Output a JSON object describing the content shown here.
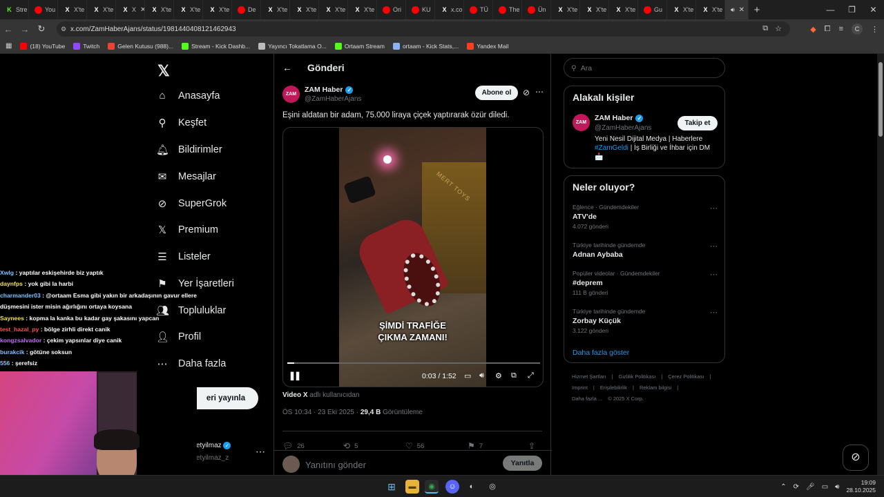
{
  "browser": {
    "tabs": [
      {
        "label": "Stre",
        "icon": "kick-icon",
        "color": "#53fc18"
      },
      {
        "label": "You",
        "icon": "youtube-icon",
        "color": "#ff0000"
      },
      {
        "label": "X'te",
        "icon": "x-icon",
        "color": "#ffffff"
      },
      {
        "label": "X'te",
        "icon": "x-icon",
        "color": "#ffffff"
      },
      {
        "label": "X",
        "icon": "x-icon",
        "color": "#ffffff"
      },
      {
        "label": "X'te",
        "icon": "x-icon",
        "color": "#ffffff"
      },
      {
        "label": "X'te",
        "icon": "x-icon",
        "color": "#ffffff"
      },
      {
        "label": "X'te",
        "icon": "x-icon",
        "color": "#ffffff"
      },
      {
        "label": "De",
        "icon": "youtube-icon",
        "color": "#ff0000"
      },
      {
        "label": "X'te",
        "icon": "x-icon",
        "color": "#ffffff"
      },
      {
        "label": "X'te",
        "icon": "x-icon",
        "color": "#ffffff"
      },
      {
        "label": "X'te",
        "icon": "x-icon",
        "color": "#ffffff"
      },
      {
        "label": "X'te",
        "icon": "x-icon",
        "color": "#ffffff"
      },
      {
        "label": "Ori",
        "icon": "youtube-icon",
        "color": "#ff0000"
      },
      {
        "label": "KU",
        "icon": "youtube-icon",
        "color": "#ff0000"
      },
      {
        "label": "x.co",
        "icon": "x-icon",
        "color": "#ffffff"
      },
      {
        "label": "TÜ",
        "icon": "youtube-icon",
        "color": "#ff0000"
      },
      {
        "label": "The",
        "icon": "youtube-icon",
        "color": "#ff0000"
      },
      {
        "label": "Ün",
        "icon": "youtube-icon",
        "color": "#ff0000"
      },
      {
        "label": "X'te",
        "icon": "x-icon",
        "color": "#ffffff"
      },
      {
        "label": "X'te",
        "icon": "x-icon",
        "color": "#ffffff"
      },
      {
        "label": "X'te",
        "icon": "x-icon",
        "color": "#ffffff"
      },
      {
        "label": "Gu",
        "icon": "youtube-icon",
        "color": "#ff0000"
      },
      {
        "label": "X'te",
        "icon": "x-icon",
        "color": "#ffffff"
      },
      {
        "label": "X'te",
        "icon": "x-icon",
        "color": "#ffffff"
      }
    ],
    "url": "x.com/ZamHaberAjans/status/1981440408121462943",
    "profile_initial": "C",
    "bookmarks": [
      {
        "label": "(18) YouTube",
        "color": "#ff0000"
      },
      {
        "label": "Twitch",
        "color": "#9146ff"
      },
      {
        "label": "Gelen Kutusu (988)...",
        "color": "#ea4335"
      },
      {
        "label": "Stream - Kick Dashb...",
        "color": "#53fc18"
      },
      {
        "label": "Yayıncı Tokatlama O...",
        "color": "#bbbbbb"
      },
      {
        "label": "Ortaam Stream",
        "color": "#53fc18"
      },
      {
        "label": "ortaam - Kick Stats,...",
        "color": "#8ab4f8"
      },
      {
        "label": "Yandex Mail",
        "color": "#fc3f1d"
      }
    ]
  },
  "nav": {
    "items": [
      {
        "label": "Anasayfa",
        "icon": "home-icon",
        "glyph": "⌂"
      },
      {
        "label": "Keşfet",
        "icon": "search-icon",
        "glyph": "⚲"
      },
      {
        "label": "Bildirimler",
        "icon": "bell-icon",
        "glyph": "🔔︎"
      },
      {
        "label": "Mesajlar",
        "icon": "mail-icon",
        "glyph": "✉"
      },
      {
        "label": "SuperGrok",
        "icon": "grok-icon",
        "glyph": "⊘"
      },
      {
        "label": "Premium",
        "icon": "x-icon",
        "glyph": "𝕏"
      },
      {
        "label": "Listeler",
        "icon": "list-icon",
        "glyph": "☰"
      },
      {
        "label": "Yer İşaretleri",
        "icon": "bookmark-icon",
        "glyph": "⚑"
      },
      {
        "label": "Topluluklar",
        "icon": "communities-icon",
        "glyph": "👥︎"
      },
      {
        "label": "Profil",
        "icon": "profile-icon",
        "glyph": "👤︎"
      },
      {
        "label": "Daha fazla",
        "icon": "more-icon",
        "glyph": "⋯"
      }
    ],
    "post_button": "eri yayınla",
    "me_name": "etyilmaz",
    "me_handle": "etyilmaz_z"
  },
  "post": {
    "header": "Gönderi",
    "author": "ZAM Haber",
    "handle": "@ZamHaberAjans",
    "avatar_text": "ZAM",
    "follow": "Abone ol",
    "text": "Eşini aldatan bir adam, 75.000 liraya çiçek yaptırarak özür diledi.",
    "caption_line1": "ŞİMDİ TRAFİĞE",
    "caption_line2": "ÇIKMA ZAMANI!",
    "shop_sign": "MERT TOYS",
    "time": "0:03 / 1:52",
    "progress": 0.027,
    "via_label": "Video X",
    "via_rest": "adlı kullanıcıdan",
    "timestamp": "ÖS 10:34 · 23 Eki 2025 ·",
    "views": "29,4 B",
    "views_label": "Görüntüleme",
    "stats": {
      "replies": "26",
      "reposts": "5",
      "likes": "56",
      "bookmarks": "7"
    },
    "reply_placeholder": "Yanıtını gönder",
    "reply_button": "Yanıtla"
  },
  "sidebar": {
    "search_placeholder": "Ara",
    "related_title": "Alakalı kişiler",
    "related": {
      "name": "ZAM Haber",
      "handle": "@ZamHaberAjans",
      "avatar_text": "ZAM",
      "follow": "Takip et",
      "bio_1": "Yeni Nesil Dijital Medya | Haberlere",
      "bio_tag": "#ZamGeldi",
      "bio_2": "| İş Birliği ve İhbar için DM",
      "bio_emoji": "📩"
    },
    "trends_title": "Neler oluyor?",
    "trends": [
      {
        "context": "Eğlence · Gündemdekiler",
        "name": "ATV'de",
        "count": "4.072 gönderi"
      },
      {
        "context": "Türkiye tarihinde gündemde",
        "name": "Adnan Aybaba",
        "count": ""
      },
      {
        "context": "Popüler videolar · Gündemdekiler",
        "name": "#deprem",
        "count": "111 B gönderi"
      },
      {
        "context": "Türkiye tarihinde gündemde",
        "name": "Zorbay Küçük",
        "count": "3.122 gönderi"
      }
    ],
    "show_more": "Daha fazla göster",
    "footer": [
      "Hizmet Şartları",
      "|",
      "Gizlilik Politikası",
      "|",
      "Çerez Politikası",
      "|",
      "Imprint",
      "|",
      "Erişilebilirlik",
      "|",
      "Reklam bilgisi",
      "|",
      "Daha fazla ...",
      "© 2025 X Corp."
    ]
  },
  "chat": [
    {
      "user": "Xwlg",
      "color": "#7cc1ff",
      "msg": "yaptılar eskişehirde biz yaptık"
    },
    {
      "user": "daynfps",
      "color": "#f3e24a",
      "msg": "yok gibi la harbi"
    },
    {
      "user": "charmander03",
      "color": "#7cc1ff",
      "msg": "@ortaam Esma gibi yakın bir arkadaşının gavur ellere düşmesini ister misin ağırlığını ortaya koysana"
    },
    {
      "user": "Saynees",
      "color": "#f3e24a",
      "msg": "kopma la kanka bu kadar gay şakasını yapcan"
    },
    {
      "user": "test_hazal_py",
      "color": "#ff4b4b",
      "msg": "bölge zirhli direkt canik"
    },
    {
      "user": "kongzsalvador",
      "color": "#c36bff",
      "msg": "çekim yapsınlar diye canik"
    },
    {
      "user": "burakcik",
      "color": "#7cc1ff",
      "msg": "götüne soksun"
    },
    {
      "user": "556",
      "color": "#7cc1ff",
      "msg": "şerefsiz"
    }
  ],
  "taskbar": {
    "time": "19:09",
    "date": "28.10.2025"
  }
}
